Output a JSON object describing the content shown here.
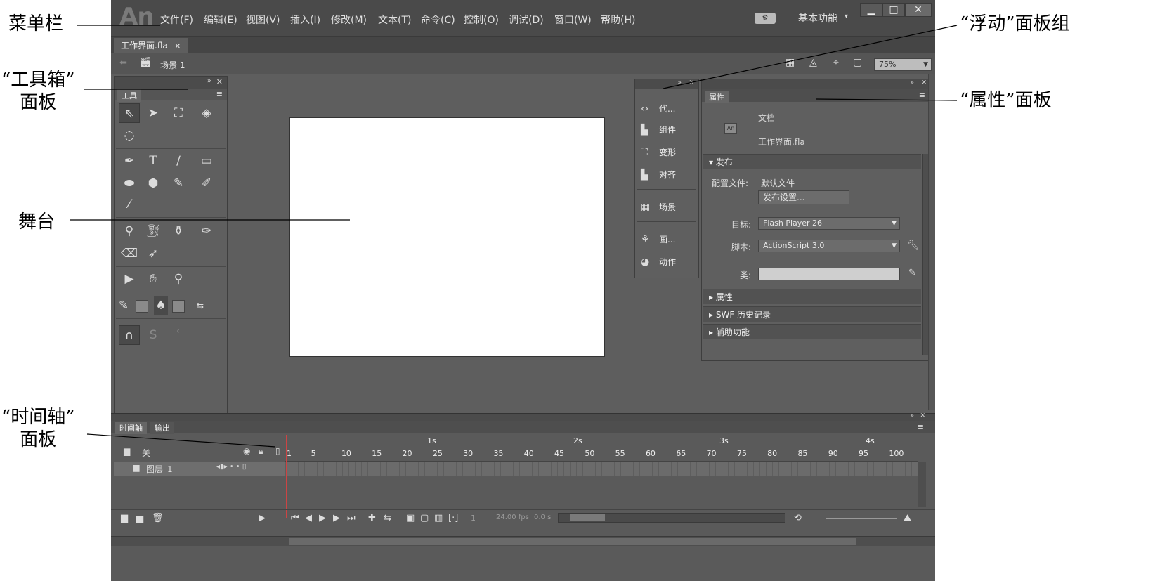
{
  "callouts": {
    "menubar": "菜单栏",
    "toolbox_1": "“工具箱”",
    "toolbox_2": "面板",
    "stage": "舞台",
    "timeline_1": "“时间轴”",
    "timeline_2": "面板",
    "floating": "“浮动”面板组",
    "properties": "“属性”面板"
  },
  "app": {
    "logo": "An",
    "menu": [
      "文件(F)",
      "编辑(E)",
      "视图(V)",
      "插入(I)",
      "修改(M)",
      "文本(T)",
      "命令(C)",
      "控制(O)",
      "调试(D)",
      "窗口(W)",
      "帮助(H)"
    ],
    "workspace": "基本功能",
    "win_min": "▁",
    "win_max": "□",
    "win_close": "✕"
  },
  "document": {
    "tab": "工作界面.fla",
    "tab_close": "✕",
    "scene": "场景 1",
    "zoom": "75%"
  },
  "tools": {
    "tab": "工具"
  },
  "floating_panel": {
    "items": [
      "代...",
      "组件",
      "变形",
      "对齐",
      "场景",
      "画...",
      "动作"
    ]
  },
  "properties": {
    "tab": "属性",
    "doc_type": "文档",
    "file_name": "工作界面.fla",
    "section_publish": "发布",
    "profile_label": "配置文件:",
    "profile_value": "默认文件",
    "publish_settings_btn": "发布设置...",
    "target_label": "目标:",
    "target_value": "Flash Player 26",
    "script_label": "脚本:",
    "script_value": "ActionScript 3.0",
    "class_label": "类:",
    "class_value": "",
    "section_props": "属性",
    "section_swf": "SWF 历史记录",
    "section_access": "辅助功能"
  },
  "timeline": {
    "tab_timeline": "时间轴",
    "tab_output": "输出",
    "folder_label": "关",
    "layer_name": "图层_1",
    "fps": "24.00 fps",
    "time": "0.0 s",
    "frame": "1",
    "ruler_seconds": [
      "1s",
      "2s",
      "3s",
      "4s"
    ],
    "ruler_frames": [
      "1",
      "5",
      "10",
      "15",
      "20",
      "25",
      "30",
      "35",
      "40",
      "45",
      "50",
      "55",
      "60",
      "65",
      "70",
      "75",
      "80",
      "85",
      "90",
      "95",
      "100"
    ]
  }
}
